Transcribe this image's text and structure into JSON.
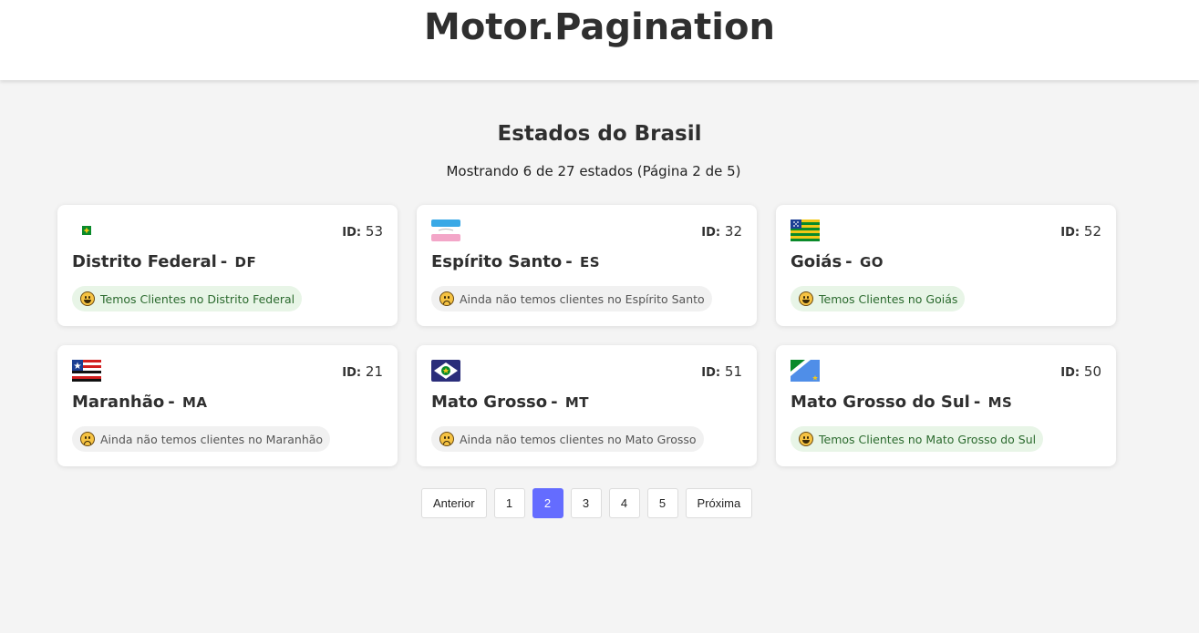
{
  "app": {
    "title": "Motor.Pagination"
  },
  "page": {
    "title": "Estados do Brasil",
    "subtitle": "Mostrando 6 de 27 estados (Página 2 de 5)"
  },
  "id_label": "ID:",
  "states": [
    {
      "name": "Distrito Federal",
      "uf": "DF",
      "id": "53",
      "has_clients": true,
      "status": "Temos Clientes no Distrito Federal"
    },
    {
      "name": "Espírito Santo",
      "uf": "ES",
      "id": "32",
      "has_clients": false,
      "status": "Ainda não temos clientes no Espírito Santo"
    },
    {
      "name": "Goiás",
      "uf": "GO",
      "id": "52",
      "has_clients": true,
      "status": "Temos Clientes no Goiás"
    },
    {
      "name": "Maranhão",
      "uf": "MA",
      "id": "21",
      "has_clients": false,
      "status": "Ainda não temos clientes no Maranhão"
    },
    {
      "name": "Mato Grosso",
      "uf": "MT",
      "id": "51",
      "has_clients": false,
      "status": "Ainda não temos clientes no Mato Grosso"
    },
    {
      "name": "Mato Grosso do Sul",
      "uf": "MS",
      "id": "50",
      "has_clients": true,
      "status": "Temos Clientes no Mato Grosso do Sul"
    }
  ],
  "pagination": {
    "prev": "Anterior",
    "next": "Próxima",
    "pages": [
      "1",
      "2",
      "3",
      "4",
      "5"
    ],
    "current": "2"
  },
  "colors": {
    "accent": "#646cff",
    "clients_bg": "#e8f5e7",
    "clients_text": "#2b6a2e",
    "no_clients_bg": "#f1f1f1"
  }
}
